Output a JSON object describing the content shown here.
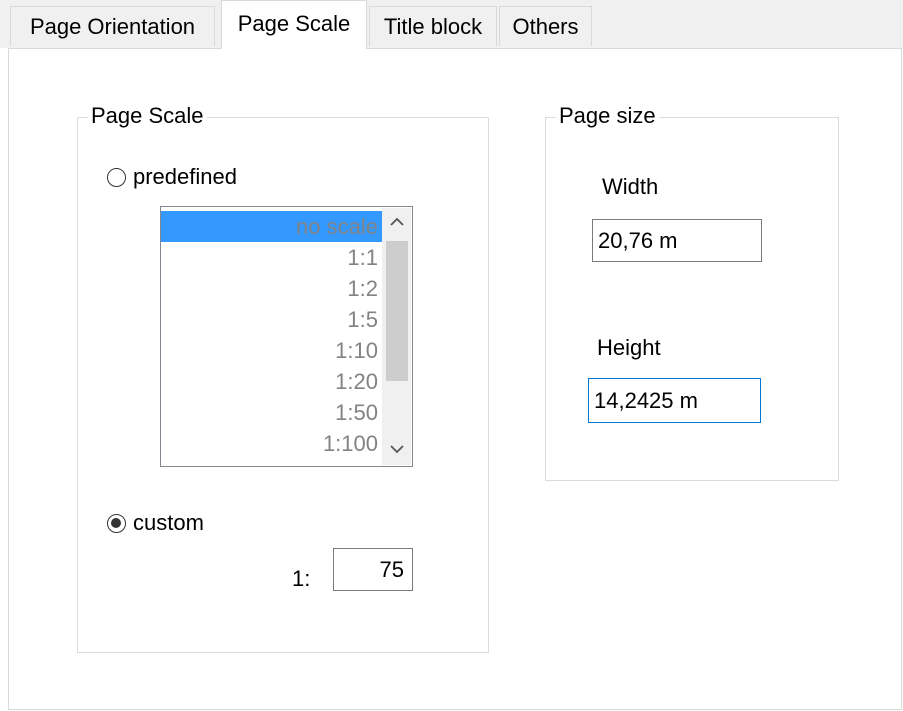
{
  "tabs": [
    {
      "label": "Page Orientation",
      "active": false
    },
    {
      "label": "Page Scale",
      "active": true
    },
    {
      "label": "Title block",
      "active": false
    },
    {
      "label": "Others",
      "active": false
    }
  ],
  "page_scale_group": {
    "title": "Page Scale",
    "predefined": {
      "label": "predefined",
      "checked": false
    },
    "scale_list": {
      "items": [
        "no scale",
        "1:1",
        "1:2",
        "1:5",
        "1:10",
        "1:20",
        "1:50",
        "1:100"
      ],
      "selected": "no scale"
    },
    "custom": {
      "label": "custom",
      "checked": true
    },
    "custom_prefix": "1:",
    "custom_value": "75"
  },
  "page_size_group": {
    "title": "Page size",
    "width_label": "Width",
    "width_value": "20,76 m",
    "height_label": "Height",
    "height_value": "14,2425 m"
  },
  "icons": {
    "scroll_up": "chevron-up-icon",
    "scroll_down": "chevron-down-icon"
  },
  "colors": {
    "selection": "#3399ff",
    "focus_border": "#0078d7",
    "disabled_text": "#838383"
  }
}
